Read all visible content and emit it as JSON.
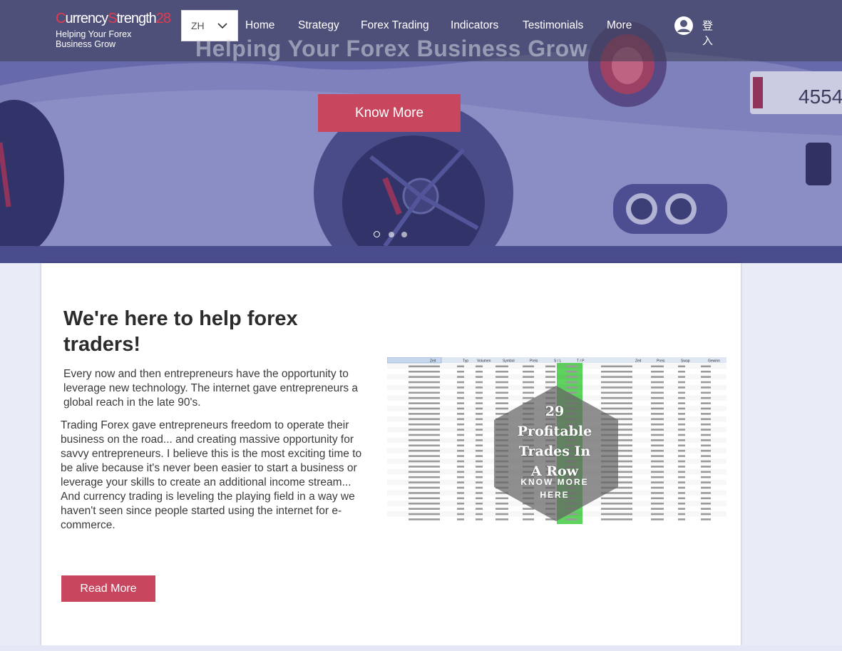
{
  "brand": {
    "name_part1": "C",
    "name_part2": "urrency",
    "name_part3": "S",
    "name_part4": "trength",
    "name_part5": "28",
    "tagline": "Helping Your Forex Business Grow"
  },
  "language": {
    "selected": "ZH"
  },
  "nav": {
    "items": [
      "Home",
      "Strategy",
      "Forex Trading",
      "Indicators",
      "Testimonials",
      "More"
    ]
  },
  "login": {
    "label": "登入"
  },
  "hero": {
    "ghost_title": "Helping Your Forex Business Grow",
    "cta_label": "Know More",
    "slides_total": 3,
    "slide_active": 1
  },
  "content": {
    "heading": "We're here to help forex traders!",
    "paragraph1": "Every now and then entrepreneurs have the opportunity to leverage new technology. The internet gave entrepreneurs a global reach in the late 90's.",
    "paragraph2": "Trading Forex gave entrepreneurs freedom to operate their business on the road... and creating massive opportunity for savvy entrepreneurs. I believe this is the most exciting time to be alive because it's never been easier to start a business or leverage your skills to create an additional income stream... And currency trading is leveling the playing field in a way we haven't seen since people started using the internet for e-commerce.",
    "read_more_label": "Read More"
  },
  "promo": {
    "title_lines": [
      "29",
      "Profitable",
      "Trades In",
      "A Row"
    ],
    "cta_lines": [
      "KNOW MORE",
      "HERE"
    ],
    "sheet_headers_left": [
      "Zeit",
      "Typ",
      "Volumen",
      "Symbol",
      "Preis",
      "S / L",
      "T / P"
    ],
    "sheet_headers_right": [
      "Zeit",
      "Preis",
      "Swap",
      "Gewinn"
    ]
  },
  "colors": {
    "accent": "#c9465f",
    "brand_red": "#e23a4e",
    "sheet_green": "#5fd35f"
  }
}
